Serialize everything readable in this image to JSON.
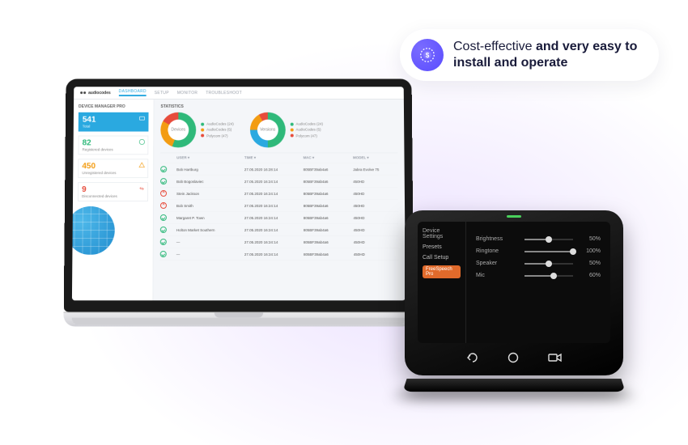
{
  "callout": {
    "line1": "Cost-effective ",
    "bold": "and very easy to install and operate"
  },
  "laptop_app": {
    "brand": "audiocodes",
    "nav": {
      "dashboard": "DASHBOARD",
      "setup": "SETUP",
      "monitor": "MONITOR",
      "troubleshoot": "TROUBLESHOOT"
    },
    "sidebar": {
      "title": "DEVICE MANAGER PRO",
      "kpis": [
        {
          "value": "541",
          "label": "Total"
        },
        {
          "value": "82",
          "label": "Registered devices"
        },
        {
          "value": "450",
          "label": "Unregistered devices"
        },
        {
          "value": "9",
          "label": "Disconnected devices"
        }
      ]
    },
    "statistics": {
      "title": "STATISTICS",
      "donut_a": {
        "label": "Devices",
        "legend": [
          "AudioCodes (24)",
          "AudioCodes (5)",
          "Polycom (47)"
        ]
      },
      "donut_b": {
        "label": "Versions",
        "legend": [
          "AudioCodes (24)",
          "AudioCodes (5)",
          "Polycom (47)"
        ]
      }
    },
    "table": {
      "headers": [
        "",
        "USER ▾",
        "TIME ▾",
        "MAC ▾",
        "MODEL ▾"
      ],
      "rows": [
        {
          "ok": true,
          "user": "Bob Hartburg",
          "time": "27.05.2020 16:28:14",
          "mac": "805BF39ab4a6",
          "model": "Jabra Evolve 75"
        },
        {
          "ok": true,
          "user": "Bob Bogoslaviec",
          "time": "27.05.2020 16:24:14",
          "mac": "805BF39ab4a6",
          "model": "450HD"
        },
        {
          "ok": false,
          "user": "Stein Jackson",
          "time": "27.05.2020 16:24:14",
          "mac": "805BF39ab4a6",
          "model": "450HD"
        },
        {
          "ok": false,
          "user": "Bob Smith",
          "time": "27.05.2020 16:24:14",
          "mac": "805BF39ab4a6",
          "model": "450HD"
        },
        {
          "ok": true,
          "user": "Margaret P. Town",
          "time": "27.05.2020 16:24:14",
          "mac": "805BF39ab4a6",
          "model": "450HD"
        },
        {
          "ok": true,
          "user": "Holton Market Southern",
          "time": "27.05.2020 16:24:14",
          "mac": "805BF39ab4a6",
          "model": "450HD"
        },
        {
          "ok": true,
          "user": "—",
          "time": "27.05.2020 16:24:14",
          "mac": "805BF39ab4a6",
          "model": "450HD"
        },
        {
          "ok": true,
          "user": "—",
          "time": "27.05.2020 16:24:14",
          "mac": "805BF39ab4a6",
          "model": "450HD"
        }
      ]
    }
  },
  "tablet": {
    "side": {
      "header": "Device Settings",
      "items": [
        "Presets",
        "Call Setup"
      ],
      "button": "FreeSpeech Pro"
    },
    "sliders": [
      {
        "label": "Brightness",
        "value": "50%",
        "pct": 50
      },
      {
        "label": "Ringtone",
        "value": "100%",
        "pct": 100
      },
      {
        "label": "Speaker",
        "value": "50%",
        "pct": 50
      },
      {
        "label": "Mic",
        "value": "60%",
        "pct": 60
      }
    ]
  }
}
